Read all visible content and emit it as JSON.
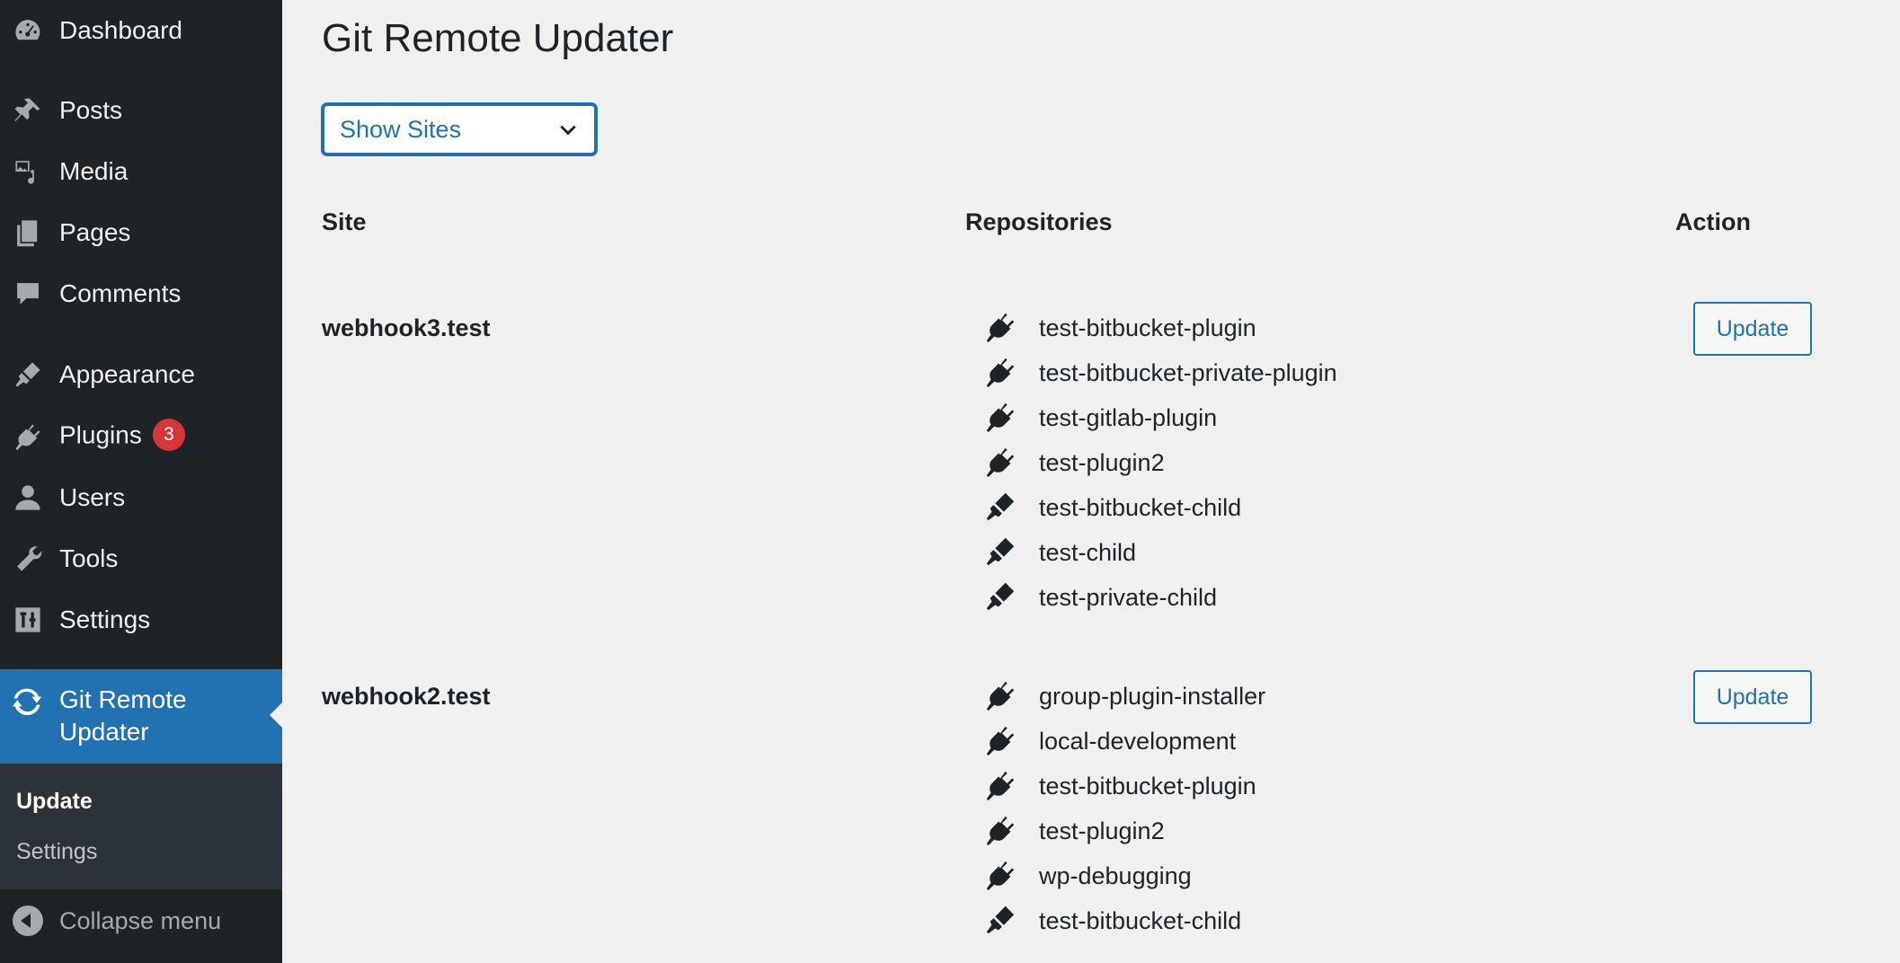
{
  "sidebar": {
    "items": [
      {
        "label": "Dashboard",
        "icon": "dashboard-icon"
      },
      {
        "label": "Posts",
        "icon": "pin-icon"
      },
      {
        "label": "Media",
        "icon": "media-icon"
      },
      {
        "label": "Pages",
        "icon": "pages-icon"
      },
      {
        "label": "Comments",
        "icon": "comment-icon"
      },
      {
        "label": "Appearance",
        "icon": "brush-icon"
      },
      {
        "label": "Plugins",
        "icon": "plugin-icon",
        "badge": "3"
      },
      {
        "label": "Users",
        "icon": "user-icon"
      },
      {
        "label": "Tools",
        "icon": "wrench-icon"
      },
      {
        "label": "Settings",
        "icon": "settings-icon"
      }
    ],
    "current": {
      "label": "Git Remote Updater",
      "icon": "refresh-icon"
    },
    "submenu": [
      "Update",
      "Settings"
    ],
    "collapse_label": "Collapse menu"
  },
  "main": {
    "title": "Git Remote Updater",
    "select": {
      "value": "Show Sites"
    },
    "columns": {
      "site": "Site",
      "repositories": "Repositories",
      "action": "Action"
    },
    "sites": [
      {
        "name": "webhook3.test",
        "button": "Update",
        "repos": [
          {
            "name": "test-bitbucket-plugin",
            "type": "plugin"
          },
          {
            "name": "test-bitbucket-private-plugin",
            "type": "plugin"
          },
          {
            "name": "test-gitlab-plugin",
            "type": "plugin"
          },
          {
            "name": "test-plugin2",
            "type": "plugin"
          },
          {
            "name": "test-bitbucket-child",
            "type": "theme"
          },
          {
            "name": "test-child",
            "type": "theme"
          },
          {
            "name": "test-private-child",
            "type": "theme"
          }
        ]
      },
      {
        "name": "webhook2.test",
        "button": "Update",
        "repos": [
          {
            "name": "group-plugin-installer",
            "type": "plugin"
          },
          {
            "name": "local-development",
            "type": "plugin"
          },
          {
            "name": "test-bitbucket-plugin",
            "type": "plugin"
          },
          {
            "name": "test-plugin2",
            "type": "plugin"
          },
          {
            "name": "wp-debugging",
            "type": "plugin"
          },
          {
            "name": "test-bitbucket-child",
            "type": "theme"
          }
        ]
      }
    ]
  },
  "colors": {
    "sidebar_bg": "#1d2327",
    "accent": "#2271b1",
    "badge": "#d63638",
    "page_bg": "#f0f0f1"
  }
}
